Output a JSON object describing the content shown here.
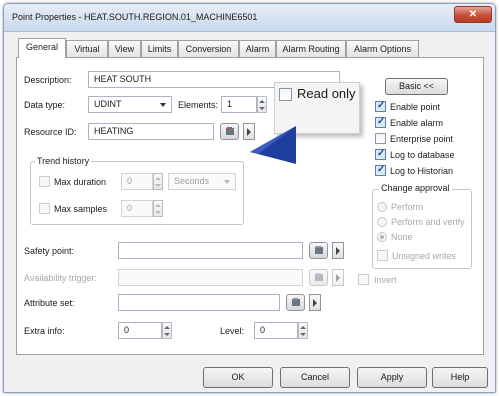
{
  "window": {
    "title": "Point Properties - HEAT.SOUTH.REGION.01_MACHINE6501",
    "close_label": "✕"
  },
  "tabs": [
    "General",
    "Virtual",
    "View",
    "Limits",
    "Conversion",
    "Alarm",
    "Alarm Routing",
    "Alarm Options"
  ],
  "general": {
    "description_label": "Description:",
    "description_value": "HEAT SOUTH",
    "datatype_label": "Data type:",
    "datatype_value": "UDINT",
    "elements_label": "Elements:",
    "elements_value": "1",
    "readonly_label": "Read only",
    "resource_label": "Resource ID:",
    "resource_value": "HEATING",
    "trend_title": "Trend history",
    "max_duration_label": "Max duration",
    "max_duration_value": "0",
    "duration_unit": "Seconds",
    "max_samples_label": "Max samples",
    "max_samples_value": "0",
    "safety_label": "Safety point:",
    "availability_label": "Availability trigger:",
    "invert_label": "Invert",
    "attribute_label": "Attribute set:",
    "extra_label": "Extra info:",
    "extra_value": "0",
    "level_label": "Level:",
    "level_value": "0",
    "basic_button": "Basic <<",
    "options": [
      {
        "label": "Enable point",
        "checked": true
      },
      {
        "label": "Enable alarm",
        "checked": true
      },
      {
        "label": "Enterprise point",
        "checked": false
      },
      {
        "label": "Log to database",
        "checked": true
      },
      {
        "label": "Log to Historian",
        "checked": true
      }
    ],
    "change_approval_title": "Change approval",
    "approval_options": [
      "Perform",
      "Perform and verify",
      "None"
    ],
    "unsigned_label": "Unsigned writes"
  },
  "footer": {
    "ok": "OK",
    "cancel": "Cancel",
    "apply": "Apply",
    "help": "Help"
  },
  "colors": {
    "callout_arrow": "#1f3f9e",
    "title_gradient_top": "#e7eef8",
    "close_red": "#c7503b"
  }
}
